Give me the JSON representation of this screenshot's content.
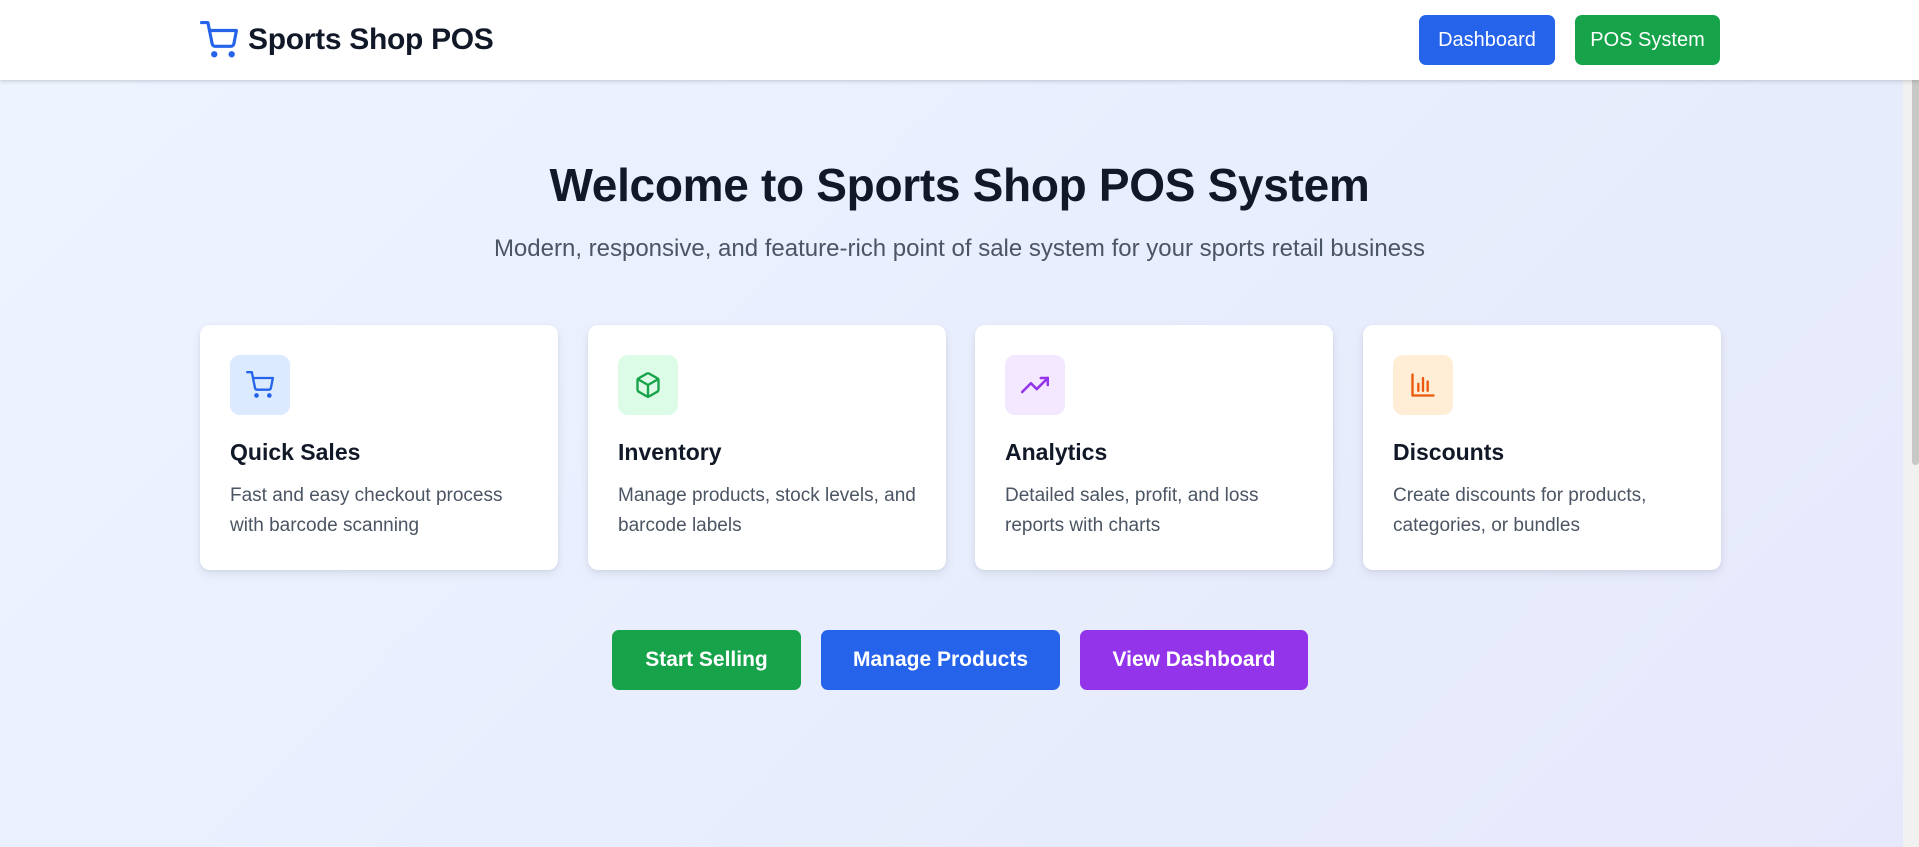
{
  "navbar": {
    "brand_icon": "shopping-cart-icon",
    "brand_title": "Sports Shop POS",
    "dashboard_label": "Dashboard",
    "pos_label": "POS System"
  },
  "hero": {
    "title": "Welcome to Sports Shop POS System",
    "subtitle": "Modern, responsive, and feature-rich point of sale system for your sports retail business"
  },
  "features": [
    {
      "icon": "shopping-cart-icon",
      "title": "Quick Sales",
      "description": "Fast and easy checkout process with barcode scanning",
      "color": "#2563eb"
    },
    {
      "icon": "package-icon",
      "title": "Inventory",
      "description": "Manage products, stock levels, and barcode labels",
      "color": "#16a34a"
    },
    {
      "icon": "trending-up-icon",
      "title": "Analytics",
      "description": "Detailed sales, profit, and loss reports with charts",
      "color": "#9333ea"
    },
    {
      "icon": "bar-chart-icon",
      "title": "Discounts",
      "description": "Create discounts for products, categories, or bundles",
      "color": "#ea580c"
    }
  ],
  "actions": {
    "start_selling": "Start Selling",
    "manage_products": "Manage Products",
    "view_dashboard": "View Dashboard"
  },
  "colors": {
    "primary_blue": "#2563eb",
    "primary_green": "#16a34a",
    "primary_purple": "#9333ea",
    "primary_orange": "#ea580c"
  }
}
